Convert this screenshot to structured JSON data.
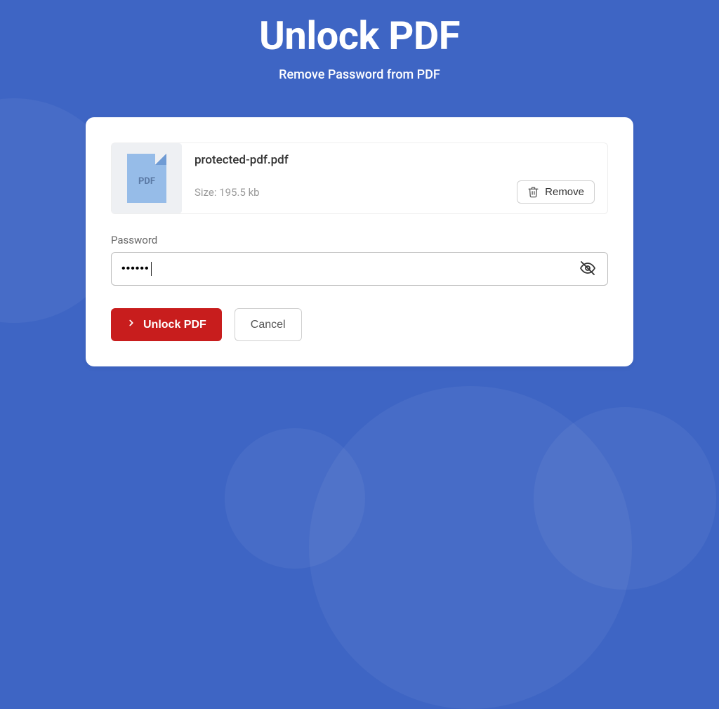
{
  "header": {
    "title": "Unlock PDF",
    "subtitle": "Remove Password from PDF"
  },
  "file": {
    "icon_label": "PDF",
    "name": "protected-pdf.pdf",
    "size_label": "Size: 195.5 kb",
    "remove_label": "Remove"
  },
  "form": {
    "password_label": "Password",
    "password_value": "••••••",
    "password_placeholder": ""
  },
  "actions": {
    "unlock_label": "Unlock PDF",
    "cancel_label": "Cancel"
  },
  "colors": {
    "background": "#3e65c4",
    "primary_button": "#c81d1d",
    "pdf_icon": "#96bce8"
  }
}
